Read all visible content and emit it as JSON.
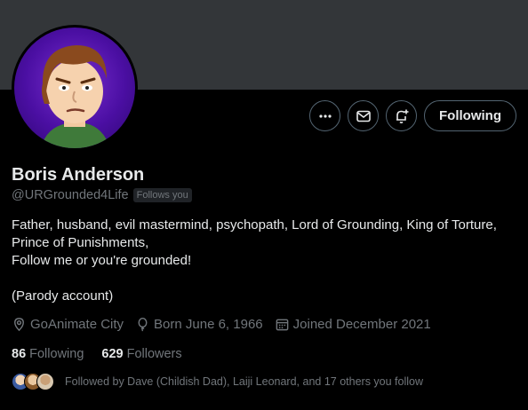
{
  "profile": {
    "name": "Boris Anderson",
    "handle": "@URGrounded4Life",
    "follows_you_badge": "Follows you",
    "bio": [
      "Father, husband, evil mastermind, psychopath, Lord of Grounding, King of Torture,",
      "Prince of Punishments,",
      "Follow me or you're grounded!",
      "",
      "(Parody account)"
    ],
    "location": "GoAnimate City",
    "birthday": "Born June 6, 1966",
    "joined": "Joined December 2021"
  },
  "actions": {
    "more_icon": "more-icon",
    "message_icon": "mail-icon",
    "notify_icon": "bell-plus-icon",
    "follow_label": "Following"
  },
  "stats": {
    "following_count": "86",
    "following_label": "Following",
    "followers_count": "629",
    "followers_label": "Followers"
  },
  "followed_by": "Followed by Dave (Childish Dad), Laiji Leonard, and 17 others you follow",
  "colors": {
    "banner": "#333639",
    "avatar_bg": "#5a16b8",
    "text_primary": "#e7e9ea",
    "text_secondary": "#71767b",
    "border": "#536471"
  }
}
